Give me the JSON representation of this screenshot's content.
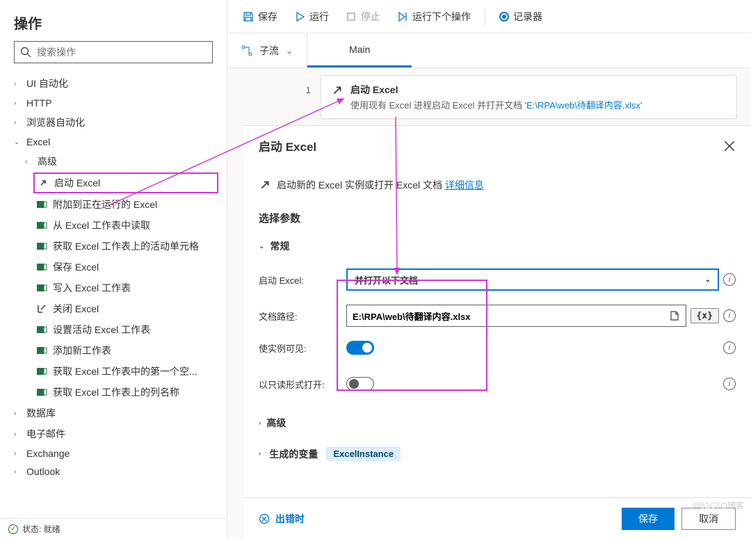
{
  "sidebar": {
    "title": "操作",
    "search_placeholder": "搜索操作",
    "nodes": {
      "ui_auto": "UI 自动化",
      "http": "HTTP",
      "browser_auto": "浏览器自动化",
      "excel": "Excel",
      "excel_adv": "高级",
      "excel_launch": "启动 Excel",
      "excel_attach": "附加到正在运行的 Excel",
      "excel_read": "从 Excel 工作表中读取",
      "excel_active_cell": "获取 Excel 工作表上的活动单元格",
      "excel_save": "保存 Excel",
      "excel_write": "写入 Excel 工作表",
      "excel_close": "关闭 Excel",
      "excel_set_active": "设置活动 Excel 工作表",
      "excel_add_sheet": "添加新工作表",
      "excel_first_empty": "获取 Excel 工作表中的第一个空...",
      "excel_col_names": "获取 Excel 工作表上的列名称",
      "database": "数据库",
      "email": "电子邮件",
      "exchange": "Exchange",
      "outlook": "Outlook"
    }
  },
  "status": {
    "label": "状态: 就绪"
  },
  "toolbar": {
    "save": "保存",
    "run": "运行",
    "stop": "停止",
    "run_next": "运行下个操作",
    "recorder": "记录器"
  },
  "subbar": {
    "subflow": "子流",
    "tab_main": "Main"
  },
  "step": {
    "number": "1",
    "title": "启动 Excel",
    "desc_prefix": "使用现有 Excel 进程启动 Excel 并打开文档 ",
    "filepath": "'E:\\RPA\\web\\待翻译内容.xlsx'"
  },
  "dialog": {
    "title": "启动 Excel",
    "info_text": "启动新的 Excel 实例或打开 Excel 文档 ",
    "learn_more": "详细信息",
    "select_params": "选择参数",
    "general": "常规",
    "launch_label": "启动 Excel:",
    "launch_value": "并打开以下文档",
    "path_label": "文档路径:",
    "path_value": "E:\\RPA\\web\\待翻译内容.xlsx",
    "var_token": "{x}",
    "visible_label": "使实例可见:",
    "readonly_label": "以只读形式打开:",
    "advanced": "高级",
    "generated": "生成的变量",
    "var_name": "ExcelInstance",
    "on_error": "出错时",
    "btn_save": "保存",
    "btn_cancel": "取消"
  },
  "watermark": "@51CTO博客"
}
